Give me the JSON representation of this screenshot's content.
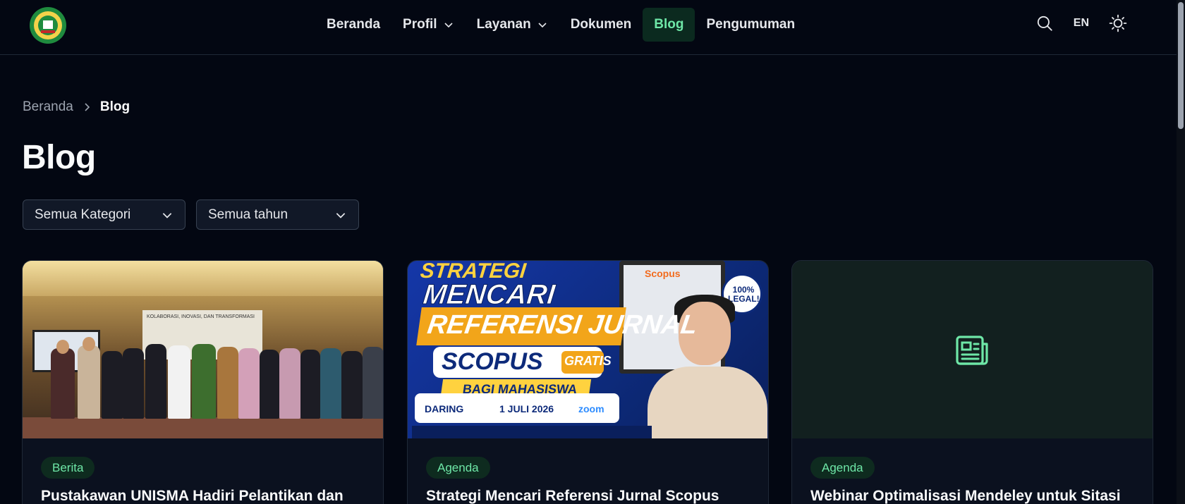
{
  "header": {
    "logo_alt": "UNIVERSITAS ISLAM MALANG UNISMA",
    "nav": [
      {
        "label": "Beranda",
        "has_dropdown": false,
        "active": false
      },
      {
        "label": "Profil",
        "has_dropdown": true,
        "active": false
      },
      {
        "label": "Layanan",
        "has_dropdown": true,
        "active": false
      },
      {
        "label": "Dokumen",
        "has_dropdown": false,
        "active": false
      },
      {
        "label": "Blog",
        "has_dropdown": false,
        "active": true
      },
      {
        "label": "Pengumuman",
        "has_dropdown": false,
        "active": false
      }
    ],
    "search_icon": "search-icon",
    "lang_label": "EN",
    "theme_icon": "sun-icon"
  },
  "breadcrumb": {
    "home": "Beranda",
    "current": "Blog"
  },
  "page": {
    "title": "Blog"
  },
  "filters": {
    "category": "Semua Kategori",
    "year": "Semua tahun"
  },
  "cards": [
    {
      "category": "Berita",
      "title": "Pustakawan UNISMA Hadiri Pelantikan dan",
      "media": "photo",
      "photo_banner_text": "KOLABORASI, INOVASI, DAN TRANSFORMASI"
    },
    {
      "category": "Agenda",
      "title": "Strategi Mencari Referensi Jurnal Scopus",
      "media": "poster",
      "poster": {
        "line1": "STRATEGI",
        "line2": "MENCARI",
        "line3": "REFERENSI JURNAL",
        "line4": "SCOPUS",
        "line4b": "GRATIS",
        "line5": "BAGI MAHASISWA",
        "mode": "DARING",
        "date": "1 JULI 2026",
        "platform": "zoom",
        "seal": "100% LEGAL!",
        "logo": "Scopus"
      }
    },
    {
      "category": "Agenda",
      "title": "Webinar Optimalisasi Mendeley untuk Sitasi",
      "media": "placeholder",
      "placeholder_icon": "newspaper-icon"
    }
  ],
  "colors": {
    "background": "#030712",
    "accent": "#6ee7a7",
    "badge_bg": "#0e2b1f",
    "card_bg": "#0b111f"
  }
}
